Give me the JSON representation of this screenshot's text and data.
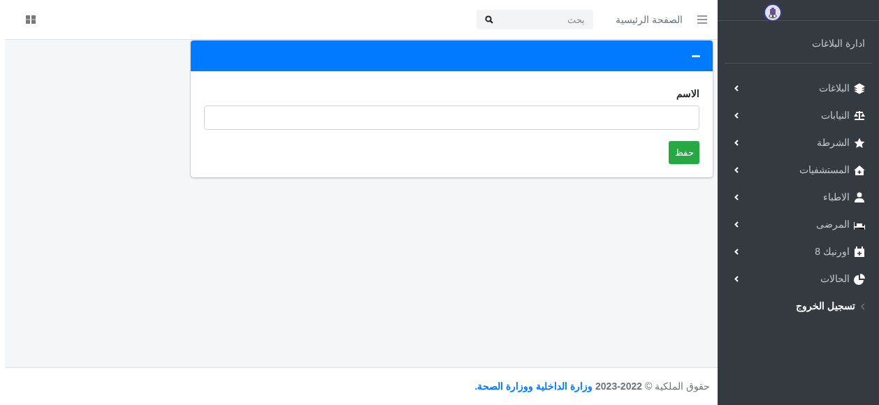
{
  "sidebar": {
    "brand": "ادارة البلاغات",
    "items": [
      {
        "label": "البلاغات",
        "kind": "submenu"
      },
      {
        "label": "النيابات",
        "kind": "submenu"
      },
      {
        "label": "الشرطة",
        "kind": "submenu"
      },
      {
        "label": "المستشفيات",
        "kind": "submenu"
      },
      {
        "label": "الاطباء",
        "kind": "submenu"
      },
      {
        "label": "المرضى",
        "kind": "submenu"
      },
      {
        "label": "اورنيك 8",
        "kind": "submenu"
      },
      {
        "label": "الحالات",
        "kind": "submenu"
      },
      {
        "label": "تسجيل الخروج",
        "kind": "link"
      }
    ]
  },
  "navbar": {
    "home_link": "الصفحة الرئيسية",
    "search": {
      "placeholder": "بحث"
    }
  },
  "card": {
    "field_label": "الاسم",
    "save_button": "حفظ"
  },
  "footer": {
    "text": "حقوق الملكية © **2022-2023**",
    "link": "وزارة الداخلية ووزارة الصحة."
  }
}
